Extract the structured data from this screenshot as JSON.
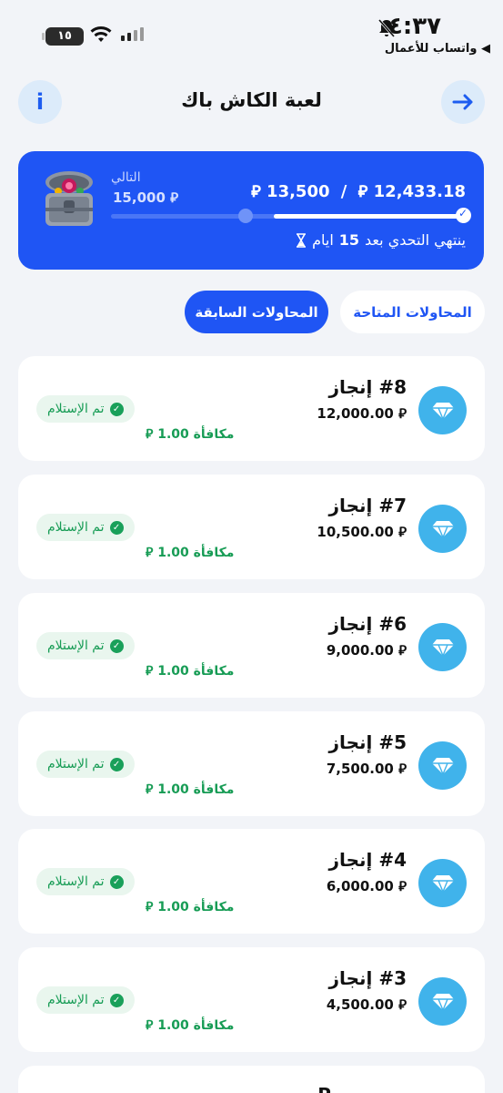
{
  "status_bar": {
    "time": "٤:٣٧",
    "back_app": "◀ واتساب للأعمال",
    "battery": "١٥",
    "bell_icon": "bell-slash-icon",
    "wifi_icon": "wifi-icon",
    "signal_icon": "signal-icon"
  },
  "header": {
    "title": "لعبة الكاش باك",
    "info_label": "i",
    "info_icon": "info-icon",
    "back_icon": "arrow-right-icon"
  },
  "challenge": {
    "next_label": "التالي",
    "next_amount": "15,000 ⃁",
    "current": "12,433.18",
    "separator": "/",
    "target": "13,500",
    "currency": "⃁",
    "progress": 0.54,
    "ends_text": "ينتهي التحدي بعد",
    "days_number": "15",
    "days_word": "ايام",
    "chest_icon": "treasure-chest-icon",
    "hourglass_icon": "hourglass-icon"
  },
  "tabs": [
    {
      "label": "المحاولات السابقة",
      "active": true
    },
    {
      "label": "المحاولات المتاحة",
      "active": false
    }
  ],
  "achievements": [
    {
      "title": "#8 إنجاز",
      "target": "12,000.00 ⃁",
      "reward": "مكافأة 1.00 ⃁",
      "status": "تم الإستلام"
    },
    {
      "title": "#7 إنجاز",
      "target": "10,500.00 ⃁",
      "reward": "مكافأة 1.00 ⃁",
      "status": "تم الإستلام"
    },
    {
      "title": "#6 إنجاز",
      "target": "9,000.00 ⃁",
      "reward": "مكافأة 1.00 ⃁",
      "status": "تم الإستلام"
    },
    {
      "title": "#5 إنجاز",
      "target": "7,500.00 ⃁",
      "reward": "مكافأة 1.00 ⃁",
      "status": "تم الإستلام"
    },
    {
      "title": "#4 إنجاز",
      "target": "6,000.00 ⃁",
      "reward": "مكافأة 1.00 ⃁",
      "status": "تم الإستلام"
    },
    {
      "title": "#3 إنجاز",
      "target": "4,500.00 ⃁",
      "reward": "مكافأة 1.00 ⃁",
      "status": "تم الإستلام"
    }
  ],
  "partial_card": {
    "text": "P..."
  },
  "colors": {
    "primary": "#1f55f4",
    "gem": "#40b3eb",
    "success": "#179c55",
    "background": "#f2f4f8"
  }
}
